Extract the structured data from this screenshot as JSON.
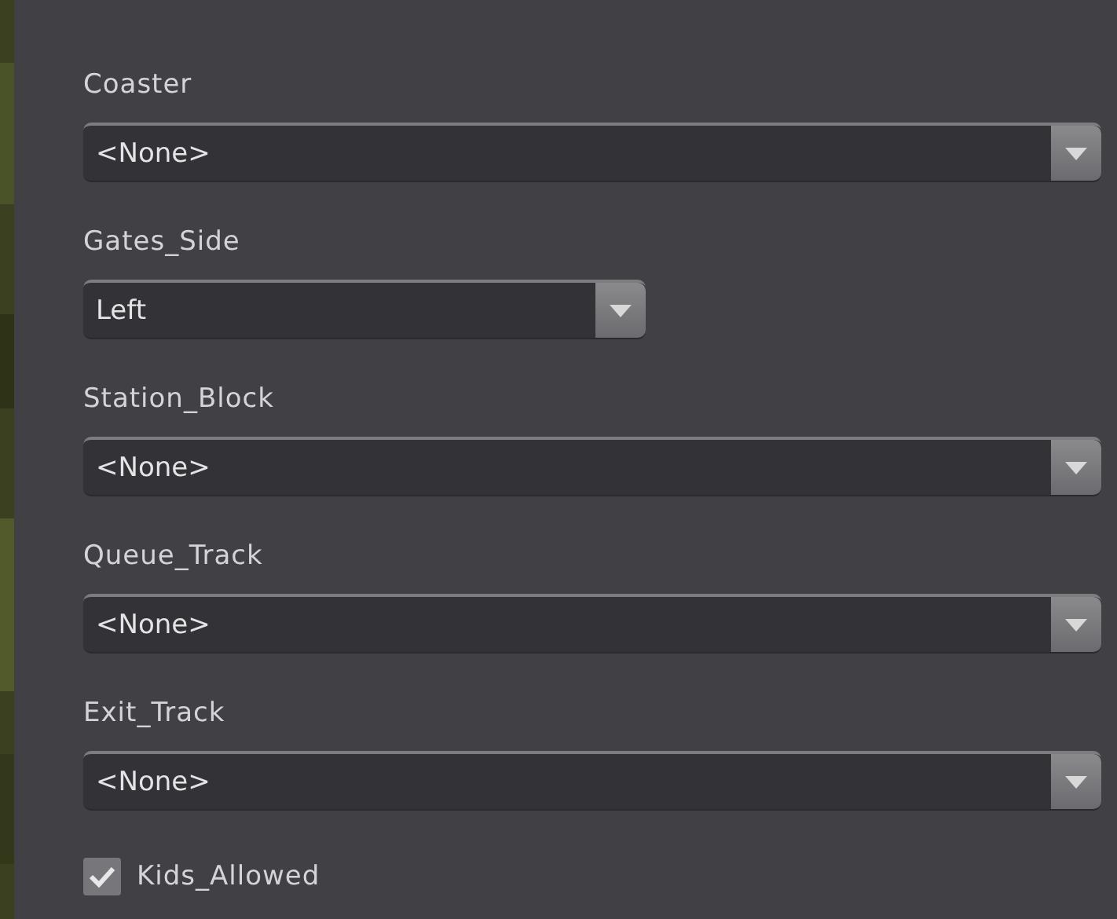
{
  "fields": [
    {
      "label": "Coaster",
      "value": "<None>",
      "kind": "wide"
    },
    {
      "label": "Gates_Side",
      "value": "Left",
      "kind": "narrow"
    },
    {
      "label": "Station_Block",
      "value": "<None>",
      "kind": "wide"
    },
    {
      "label": "Queue_Track",
      "value": "<None>",
      "kind": "wide"
    },
    {
      "label": "Exit_Track",
      "value": "<None>",
      "kind": "wide"
    }
  ],
  "checkbox": {
    "label": "Kids_Allowed",
    "checked": true
  }
}
